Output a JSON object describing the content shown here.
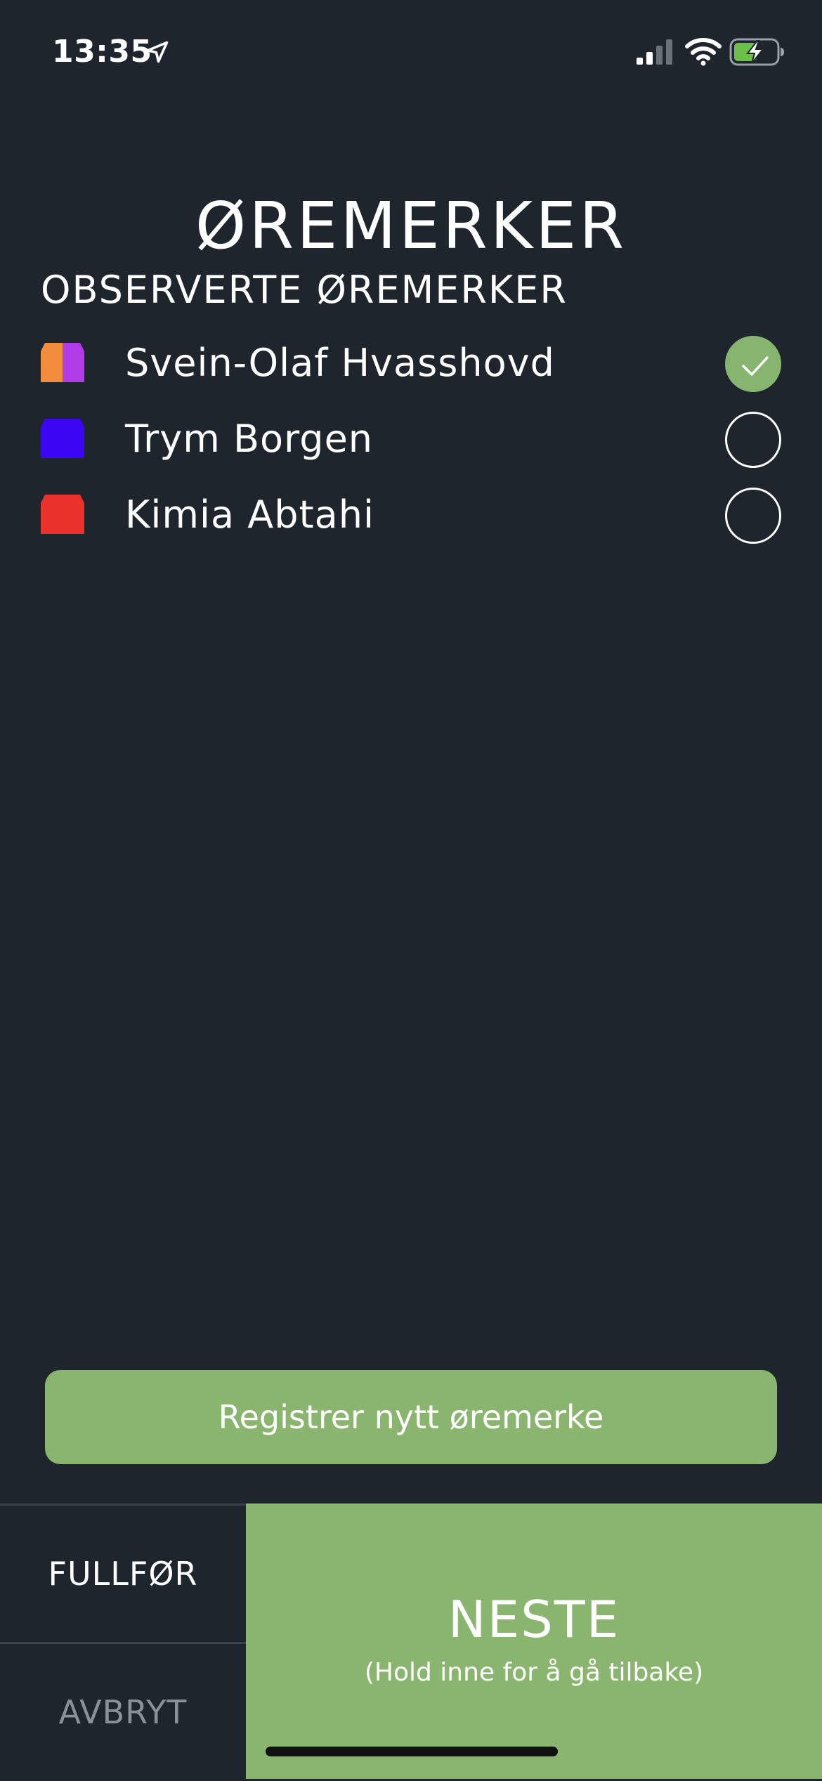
{
  "status_bar": {
    "time": "13:35",
    "location_icon": "location-arrow-icon",
    "signal_icon": "cellular-signal-icon",
    "wifi_icon": "wifi-icon",
    "battery_icon": "battery-charging-icon"
  },
  "title": "ØREMERKER",
  "section_heading": "OBSERVERTE ØREMERKER",
  "tags": [
    {
      "name": "Svein-Olaf Hvasshovd",
      "colors": [
        "#f28d3b",
        "#b23be8"
      ],
      "checked": true
    },
    {
      "name": "Trym Borgen",
      "colors": [
        "#3a06f4"
      ],
      "checked": false
    },
    {
      "name": "Kimia Abtahi",
      "colors": [
        "#e8322b"
      ],
      "checked": false
    }
  ],
  "register_button": "Registrer nytt øremerke",
  "bottom": {
    "finish": "FULLFØR",
    "cancel": "AVBRYT",
    "next": "NESTE",
    "next_hint": "(Hold inne for å gå tilbake)"
  },
  "colors": {
    "background": "#1f252d",
    "accent_green": "#8ab56e",
    "muted_text": "#8b9199"
  }
}
